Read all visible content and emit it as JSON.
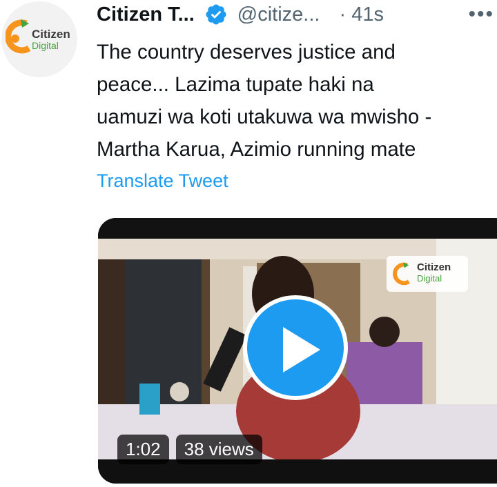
{
  "account": {
    "display_name": "Citizen T...",
    "handle": "@citize...",
    "time": "· 41s",
    "avatar_logo_line1": "Citizen",
    "avatar_logo_line2": "Digital",
    "verified_icon": "verified-badge-icon"
  },
  "more_icon": "•••",
  "tweet": {
    "lines": [
      "The country deserves justice and",
      "peace... Lazima tupate haki na",
      "uamuzi wa koti utakuwa wa mwisho -",
      "Martha Karua, Azimio running mate"
    ],
    "translate_label": "Translate Tweet"
  },
  "video": {
    "duration": "1:02",
    "views": "38 views",
    "watermark_line1": "Citizen",
    "watermark_line2": "Digital",
    "play_icon": "play-icon"
  },
  "colors": {
    "accent": "#1d9bf0",
    "brand_orange": "#f7941d",
    "brand_green": "#46a33e"
  }
}
